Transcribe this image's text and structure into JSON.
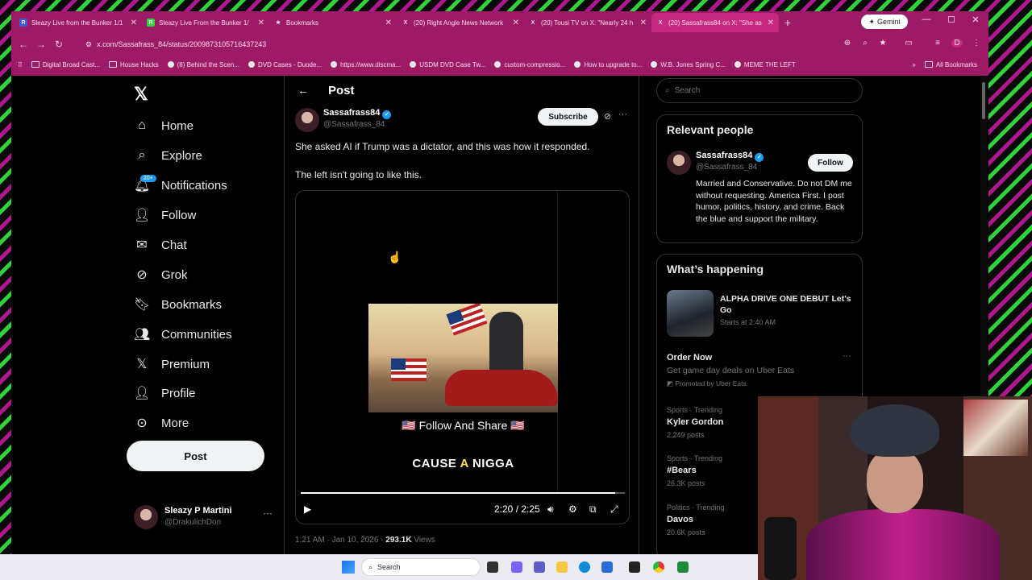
{
  "browser": {
    "tabs": [
      {
        "title": "Sleazy Live from the Bunker 1/1",
        "icon": "R",
        "icon_color": "#3b5bdb"
      },
      {
        "title": "Sleazy Live From the Bunker 1/",
        "icon": "R",
        "icon_color": "#2fd43a"
      },
      {
        "title": "Bookmarks",
        "icon": "★",
        "icon_color": "transparent"
      },
      {
        "title": "(20) Right Angle News Network",
        "icon": "X",
        "icon_color": "transparent"
      },
      {
        "title": "(20) Tousi TV on X: \"Nearly 24 h",
        "icon": "X",
        "icon_color": "transparent"
      },
      {
        "title": "(20) Sassafrass84 on X: \"She as",
        "icon": "X",
        "icon_color": "transparent"
      }
    ],
    "gemini_label": "Gemini",
    "url": "x.com/Sassafrass_84/status/2009873105716437243",
    "bookmarks": [
      "Digital Broad Cast...",
      "House Hacks",
      "(8) Behind the Scen...",
      "DVD Cases - Duode...",
      "https://www.discma...",
      "USDM DVD Case Tw...",
      "custom-compressio...",
      "How to upgrade to...",
      "W.B. Jones Spring C...",
      "MEME THE LEFT"
    ],
    "all_bookmarks": "All Bookmarks",
    "profile_initial": "D"
  },
  "nav": {
    "items": [
      {
        "label": "Home",
        "icon": "home-icon"
      },
      {
        "label": "Explore",
        "icon": "search-icon"
      },
      {
        "label": "Notifications",
        "icon": "bell-icon"
      },
      {
        "label": "Follow",
        "icon": "person-plus-icon"
      },
      {
        "label": "Chat",
        "icon": "mail-icon"
      },
      {
        "label": "Grok",
        "icon": "grok-icon"
      },
      {
        "label": "Bookmarks",
        "icon": "bookmark-icon"
      },
      {
        "label": "Communities",
        "icon": "people-icon"
      },
      {
        "label": "Premium",
        "icon": "x-icon"
      },
      {
        "label": "Profile",
        "icon": "person-icon"
      },
      {
        "label": "More",
        "icon": "more-circle-icon"
      }
    ],
    "notification_badge": "20+",
    "post_button": "Post",
    "account": {
      "name": "Sleazy P Martini",
      "handle": "@DrakulichDon"
    }
  },
  "post": {
    "header_title": "Post",
    "author_name": "Sassafrass84",
    "author_handle": "@Sassafrass_84",
    "subscribe_label": "Subscribe",
    "text_line1": "She asked AI if Trump was a dictator, and this was how it responded.",
    "text_line2": "The left isn't going to like this.",
    "video": {
      "caption": "🇺🇸 Follow And Share 🇺🇸",
      "subtitle_a": "CAUSE ",
      "subtitle_hl": "A",
      "subtitle_b": " NIGGA",
      "time": "2:20 / 2:25",
      "progress": 0.97
    },
    "timestamp": "1:21 AM · Jan 10, 2026 · ",
    "views_count": "293.1K",
    "views_label": " Views"
  },
  "sidebar": {
    "search_placeholder": "Search",
    "relevant_title": "Relevant people",
    "person": {
      "name": "Sassafrass84",
      "handle": "@Sassafrass_84",
      "follow_label": "Follow",
      "bio": "Married and Conservative. Do not DM me without requesting. America First. I post humor, politics, history, and crime. Back the blue and support the military."
    },
    "happening_title": "What’s happening",
    "featured": {
      "title": "ALPHA DRIVE ONE DEBUT Let's Go",
      "sub": "Starts at 2:40 AM"
    },
    "promo": {
      "title": "Order Now",
      "desc": "Get game day deals on Uber Eats",
      "promoted": "Promoted by Uber Eats"
    },
    "trends": [
      {
        "meta": "Sports · Trending",
        "name": "Kyler Gordon",
        "count": "2,249 posts"
      },
      {
        "meta": "Sports · Trending",
        "name": "#Bears",
        "count": "26.3K posts"
      },
      {
        "meta": "Politics · Trending",
        "name": "Davos",
        "count": "20.6K posts"
      }
    ]
  },
  "taskbar": {
    "search_label": "Search"
  }
}
